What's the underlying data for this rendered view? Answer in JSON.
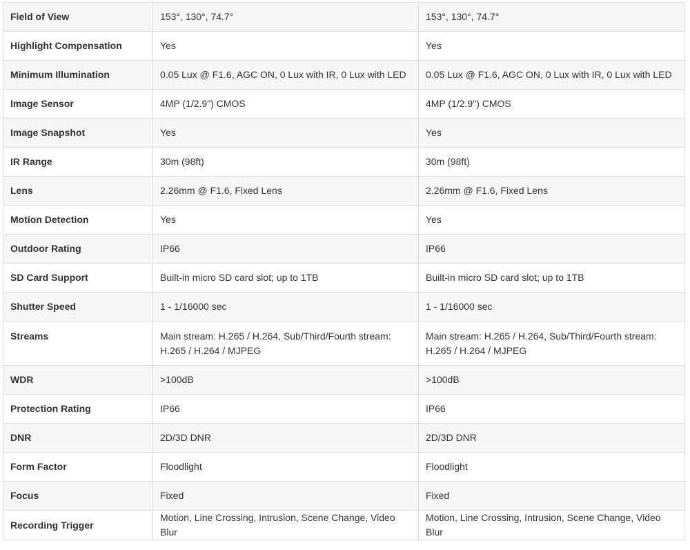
{
  "spec_table": {
    "rows": [
      {
        "name": "Field of View",
        "a": "153°, 130°, 74.7°",
        "b": "153°, 130°, 74.7°"
      },
      {
        "name": "Highlight Compensation",
        "a": "Yes",
        "b": "Yes"
      },
      {
        "name": "Minimum Illumination",
        "a": "0.05 Lux @ F1.6, AGC ON, 0 Lux with IR, 0 Lux with LED",
        "b": "0.05 Lux @ F1.6, AGC ON, 0 Lux with IR, 0 Lux with LED"
      },
      {
        "name": "Image Sensor",
        "a": "4MP (1/2.9\") CMOS",
        "b": "4MP (1/2.9\") CMOS"
      },
      {
        "name": "Image Snapshot",
        "a": "Yes",
        "b": "Yes"
      },
      {
        "name": "IR Range",
        "a": "30m (98ft)",
        "b": "30m (98ft)"
      },
      {
        "name": "Lens",
        "a": "2.26mm @ F1.6, Fixed Lens",
        "b": "2.26mm @ F1.6, Fixed Lens"
      },
      {
        "name": "Motion Detection",
        "a": "Yes",
        "b": "Yes"
      },
      {
        "name": "Outdoor Rating",
        "a": "IP66",
        "b": "IP66"
      },
      {
        "name": "SD Card Support",
        "a": "Built-in micro SD card slot; up to 1TB",
        "b": "Built-in micro SD card slot; up to 1TB"
      },
      {
        "name": "Shutter Speed",
        "a": "1 - 1/16000 sec",
        "b": "1 - 1/16000 sec"
      },
      {
        "name": "Streams",
        "a": "Main stream: H.265 / H.264, Sub/Third/Fourth stream: H.265 / H.264 / MJPEG",
        "b": "Main stream: H.265 / H.264, Sub/Third/Fourth stream: H.265 / H.264 / MJPEG"
      },
      {
        "name": "WDR",
        "a": ">100dB",
        "b": ">100dB"
      },
      {
        "name": "Protection Rating",
        "a": "IP66",
        "b": "IP66"
      },
      {
        "name": "DNR",
        "a": "2D/3D DNR",
        "b": "2D/3D DNR"
      },
      {
        "name": "Form Factor",
        "a": "Floodlight",
        "b": "Floodlight"
      },
      {
        "name": "Focus",
        "a": "Fixed",
        "b": "Fixed"
      },
      {
        "name": "Recording Trigger",
        "a": "Motion, Line Crossing, Intrusion, Scene Change, Video Blur",
        "b": "Motion, Line Crossing, Intrusion, Scene Change, Video Blur"
      }
    ]
  }
}
